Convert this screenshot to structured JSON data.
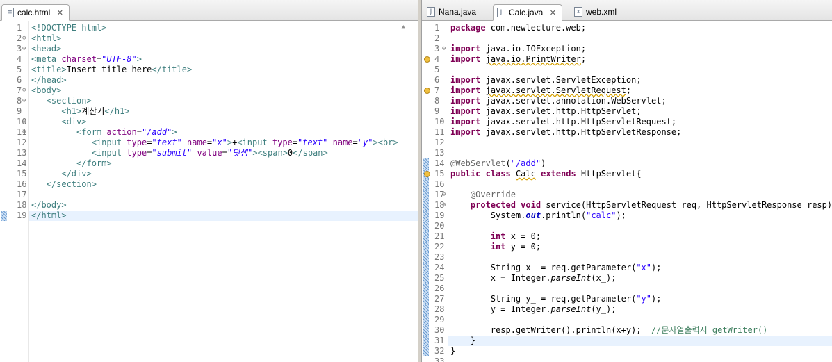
{
  "left_editor": {
    "tab": {
      "label": "calc.html",
      "icon": "html-file-icon"
    },
    "lines": [
      [
        [
          "tg",
          "<!DOCTYPE html>"
        ]
      ],
      [
        [
          "tg",
          "<html>"
        ]
      ],
      [
        [
          "tg",
          "<head>"
        ]
      ],
      [
        [
          "tg",
          "<meta "
        ],
        [
          "at",
          "charset"
        ],
        [
          "p",
          "="
        ],
        [
          "av",
          "\"UTF-8\""
        ],
        [
          "tg",
          ">"
        ]
      ],
      [
        [
          "tg",
          "<title>"
        ],
        [
          "p",
          "Insert title here"
        ],
        [
          "tg",
          "</title>"
        ]
      ],
      [
        [
          "tg",
          "</head>"
        ]
      ],
      [
        [
          "tg",
          "<body>"
        ]
      ],
      [
        [
          "p",
          "   "
        ],
        [
          "tg",
          "<section>"
        ]
      ],
      [
        [
          "p",
          "      "
        ],
        [
          "tg",
          "<h1>"
        ],
        [
          "p",
          "계산기"
        ],
        [
          "tg",
          "</h1>"
        ]
      ],
      [
        [
          "p",
          "      "
        ],
        [
          "tg",
          "<div>"
        ]
      ],
      [
        [
          "p",
          "         "
        ],
        [
          "tg",
          "<form "
        ],
        [
          "at",
          "action"
        ],
        [
          "p",
          "="
        ],
        [
          "av",
          "\"/add\""
        ],
        [
          "tg",
          ">"
        ]
      ],
      [
        [
          "p",
          "            "
        ],
        [
          "tg",
          "<input "
        ],
        [
          "at",
          "type"
        ],
        [
          "p",
          "="
        ],
        [
          "av",
          "\"text\""
        ],
        [
          "p",
          " "
        ],
        [
          "at",
          "name"
        ],
        [
          "p",
          "="
        ],
        [
          "av",
          "\"x\""
        ],
        [
          "tg",
          ">"
        ],
        [
          "p",
          "+"
        ],
        [
          "tg",
          "<input "
        ],
        [
          "at",
          "type"
        ],
        [
          "p",
          "="
        ],
        [
          "av",
          "\"text\""
        ],
        [
          "p",
          " "
        ],
        [
          "at",
          "name"
        ],
        [
          "p",
          "="
        ],
        [
          "av",
          "\"y\""
        ],
        [
          "tg",
          "><br>"
        ]
      ],
      [
        [
          "p",
          "            "
        ],
        [
          "tg",
          "<input "
        ],
        [
          "at",
          "type"
        ],
        [
          "p",
          "="
        ],
        [
          "av",
          "\"submit\""
        ],
        [
          "p",
          " "
        ],
        [
          "at",
          "value"
        ],
        [
          "p",
          "="
        ],
        [
          "av",
          "\"덧셈\""
        ],
        [
          "tg",
          "><span>"
        ],
        [
          "p",
          "0"
        ],
        [
          "tg",
          "</span>"
        ]
      ],
      [
        [
          "p",
          "         "
        ],
        [
          "tg",
          "</form>"
        ]
      ],
      [
        [
          "p",
          "      "
        ],
        [
          "tg",
          "</div>"
        ]
      ],
      [
        [
          "p",
          "   "
        ],
        [
          "tg",
          "</section>"
        ]
      ],
      [],
      [
        [
          "tg",
          "</body>"
        ]
      ],
      [
        [
          "tg",
          "</html>"
        ]
      ]
    ]
  },
  "right_editor": {
    "tabs": [
      {
        "label": "Nana.java",
        "icon": "java-file-icon"
      },
      {
        "label": "Calc.java",
        "icon": "java-file-icon",
        "active": true
      },
      {
        "label": "web.xml",
        "icon": "xml-file-icon"
      }
    ],
    "lines": [
      [
        [
          "kw",
          "package"
        ],
        [
          "p",
          " com.newlecture.web;"
        ]
      ],
      [],
      [
        [
          "kw",
          "import"
        ],
        [
          "p",
          " java.io.IOException;"
        ]
      ],
      [
        [
          "kw",
          "import"
        ],
        [
          "p",
          " "
        ],
        [
          "sq",
          "java.io.PrintWriter"
        ],
        [
          "p",
          ";"
        ]
      ],
      [],
      [
        [
          "kw",
          "import"
        ],
        [
          "p",
          " javax.servlet.ServletException;"
        ]
      ],
      [
        [
          "kw",
          "import"
        ],
        [
          "p",
          " "
        ],
        [
          "sq",
          "javax.servlet.ServletRequest"
        ],
        [
          "p",
          ";"
        ]
      ],
      [
        [
          "kw",
          "import"
        ],
        [
          "p",
          " javax.servlet.annotation.WebServlet;"
        ]
      ],
      [
        [
          "kw",
          "import"
        ],
        [
          "p",
          " javax.servlet.http.HttpServlet;"
        ]
      ],
      [
        [
          "kw",
          "import"
        ],
        [
          "p",
          " javax.servlet.http.HttpServletRequest;"
        ]
      ],
      [
        [
          "kw",
          "import"
        ],
        [
          "p",
          " javax.servlet.http.HttpServletResponse;"
        ]
      ],
      [],
      [],
      [
        [
          "an",
          "@WebServlet"
        ],
        [
          "p",
          "("
        ],
        [
          "st",
          "\"/add\""
        ],
        [
          "p",
          ")"
        ]
      ],
      [
        [
          "kw",
          "public"
        ],
        [
          "p",
          " "
        ],
        [
          "kw",
          "class"
        ],
        [
          "p",
          " "
        ],
        [
          "sq",
          "Calc"
        ],
        [
          "p",
          " "
        ],
        [
          "kw",
          "extends"
        ],
        [
          "p",
          " HttpServlet{"
        ]
      ],
      [],
      [
        [
          "p",
          "    "
        ],
        [
          "an",
          "@Override"
        ]
      ],
      [
        [
          "p",
          "    "
        ],
        [
          "kw",
          "protected"
        ],
        [
          "p",
          " "
        ],
        [
          "kw",
          "void"
        ],
        [
          "p",
          " service(HttpServletRequest req, HttpServletResponse resp) throws ServletException, IOException {"
        ]
      ],
      [
        [
          "p",
          "        System."
        ],
        [
          "bi",
          "out"
        ],
        [
          "p",
          ".println("
        ],
        [
          "st",
          "\"calc\""
        ],
        [
          "p",
          ");"
        ]
      ],
      [],
      [
        [
          "p",
          "        "
        ],
        [
          "kw",
          "int"
        ],
        [
          "p",
          " x = 0;"
        ]
      ],
      [
        [
          "p",
          "        "
        ],
        [
          "kw",
          "int"
        ],
        [
          "p",
          " y = 0;"
        ]
      ],
      [],
      [
        [
          "p",
          "        String x_ = req.getParameter("
        ],
        [
          "st",
          "\"x\""
        ],
        [
          "p",
          ");"
        ]
      ],
      [
        [
          "p",
          "        x = Integer."
        ],
        [
          "it",
          "parseInt"
        ],
        [
          "p",
          "(x_);"
        ]
      ],
      [],
      [
        [
          "p",
          "        String y_ = req.getParameter("
        ],
        [
          "st",
          "\"y\""
        ],
        [
          "p",
          ");"
        ]
      ],
      [
        [
          "p",
          "        y = Integer."
        ],
        [
          "it",
          "parseInt"
        ],
        [
          "p",
          "(y_);"
        ]
      ],
      [],
      [
        [
          "p",
          "        resp.getWriter().println(x+y);  "
        ],
        [
          "cm",
          "//문자열출력시 getWriter()"
        ]
      ],
      [
        [
          "p",
          "    }"
        ]
      ],
      [
        [
          "p",
          "}"
        ]
      ],
      []
    ]
  }
}
